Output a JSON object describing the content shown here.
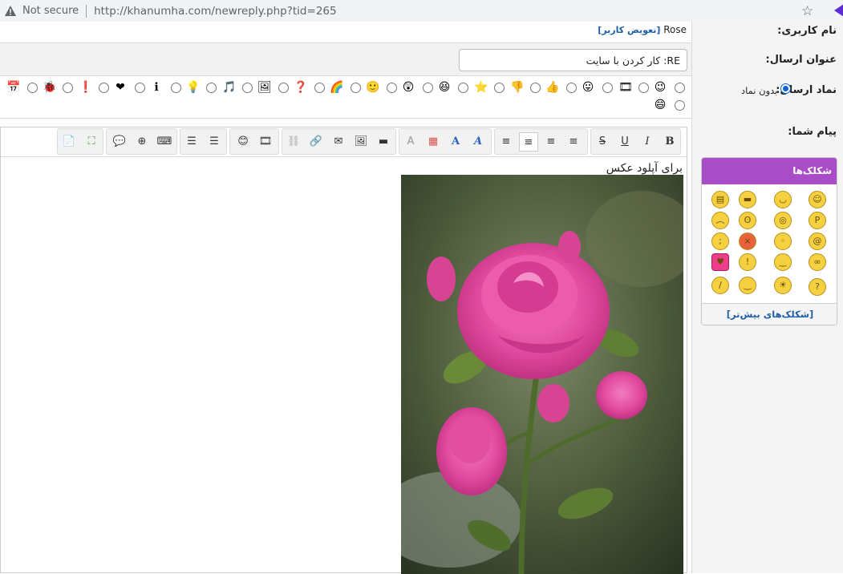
{
  "browser": {
    "security_label": "Not secure",
    "url": "http://khanumha.com/newreply.php?tid=265"
  },
  "form": {
    "username_label": "نام کاربری:",
    "username_value": "Rose",
    "switch_user": "[تعویض کاربر]",
    "subject_label": "عنوان ارسال:",
    "subject_value": "RE: کار کردن با سایت",
    "icon_label": "نماد ارسال:",
    "no_icon": "بدون نماد",
    "message_label": "پیام شما:",
    "message_text": "برای آپلود عکس"
  },
  "smilies": {
    "header": "شکلک‌ها",
    "more": "[شکلک‌های بیش‌تر]"
  },
  "colors": {
    "accent": "#a94cc8",
    "link": "#1f5fa8"
  }
}
